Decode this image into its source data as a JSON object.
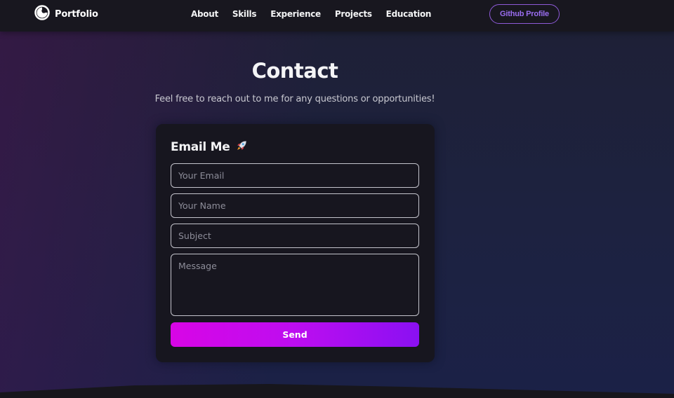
{
  "nav": {
    "brand": "Portfolio",
    "links": [
      "About",
      "Skills",
      "Experience",
      "Projects",
      "Education"
    ],
    "github_label": "Github Profile"
  },
  "contact": {
    "title": "Contact",
    "subtitle": "Feel free to reach out to me for any questions or opportunities!"
  },
  "form": {
    "heading": "Email Me",
    "heading_emoji": "rocket-icon",
    "email_placeholder": "Your Email",
    "name_placeholder": "Your Name",
    "subject_placeholder": "Subject",
    "message_placeholder": "Message",
    "send_label": "Send"
  },
  "colors": {
    "accent_purple": "#8e5ad8",
    "send_gradient_start": "#d805e6",
    "send_gradient_end": "#8a10f2",
    "card_bg": "#17161f",
    "nav_bg": "#18171f"
  }
}
